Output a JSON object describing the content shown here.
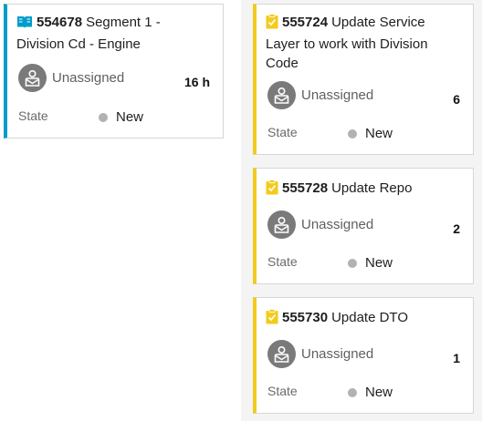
{
  "cards": [
    {
      "id": "554678",
      "title": "Segment 1 - Division Cd - Engine",
      "type_icon": "book-icon",
      "assignee": "Unassigned",
      "effort": "16 h",
      "state_label": "State",
      "state_value": "New"
    },
    {
      "id": "555724",
      "title": "Update Service Layer to work with Division Code",
      "type_icon": "task-clipboard-icon",
      "assignee": "Unassigned",
      "effort": "6",
      "state_label": "State",
      "state_value": "New"
    },
    {
      "id": "555728",
      "title": "Update Repo",
      "type_icon": "task-clipboard-icon",
      "assignee": "Unassigned",
      "effort": "2",
      "state_label": "State",
      "state_value": "New"
    },
    {
      "id": "555730",
      "title": "Update DTO",
      "type_icon": "task-clipboard-icon",
      "assignee": "Unassigned",
      "effort": "1",
      "state_label": "State",
      "state_value": "New"
    }
  ],
  "colors": {
    "feature_accent": "#009ccc",
    "task_accent": "#f2cb1d",
    "state_new_dot": "#b2b2b2",
    "avatar_bg": "#7a7a7a"
  }
}
